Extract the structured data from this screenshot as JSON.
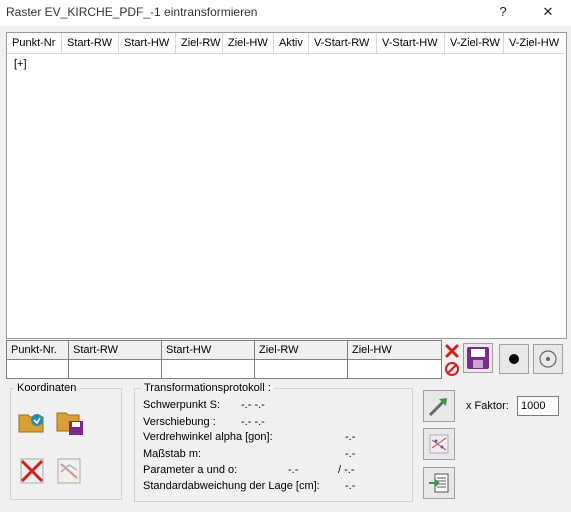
{
  "window": {
    "title": "Raster EV_KIRCHE_PDF_-1 eintransformieren",
    "help_label": "?",
    "close_label": "✕"
  },
  "grid": {
    "columns": [
      "Punkt-Nr",
      "Start-RW",
      "Start-HW",
      "Ziel-RW",
      "Ziel-HW",
      "Aktiv",
      "V-Start-RW",
      "V-Start-HW",
      "V-Ziel-RW",
      "V-Ziel-HW"
    ],
    "add_row_label": "[+]"
  },
  "entry": {
    "columns": [
      "Punkt-Nr.",
      "Start-RW",
      "Start-HW",
      "Ziel-RW",
      "Ziel-HW"
    ]
  },
  "koordinaten": {
    "label": "Koordinaten"
  },
  "protokoll": {
    "label": "Transformationsprotokoll :",
    "rows": [
      {
        "label": "Schwerpunkt S:",
        "value": "-.-  -.-"
      },
      {
        "label": "Verschiebung :",
        "value": "-.-  -.-"
      },
      {
        "label": "Verdrehwinkel alpha [gon]:",
        "value": "-.-"
      },
      {
        "label": "Maßstab m:",
        "value": "-.-"
      },
      {
        "label": "Parameter a und o:",
        "value": "-.-",
        "value2": "/ -.-"
      },
      {
        "label": "Standardabweichung der Lage [cm]:",
        "value": "-.-"
      }
    ]
  },
  "faktor": {
    "label": "x Faktor:",
    "value": "1000"
  },
  "colors": {
    "accent": "#7a2a8a",
    "delete_red": "#d0201a"
  }
}
